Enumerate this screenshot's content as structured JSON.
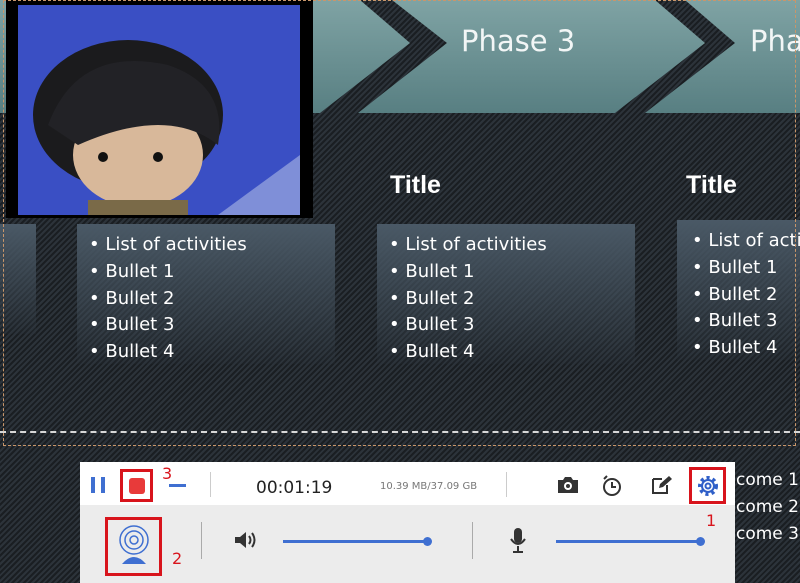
{
  "slide": {
    "phases": [
      "Phase 3",
      "Pha"
    ],
    "titles": [
      "Title",
      "Title"
    ],
    "columns": [
      [
        "• List of activities",
        "• Bullet 1",
        "• Bullet 2",
        "• Bullet 3",
        "• Bullet 4"
      ],
      [
        "• List of activities",
        "• Bullet 1",
        "• Bullet 2",
        "• Bullet 3",
        "• Bullet 4"
      ],
      [
        "• List of activi",
        "• Bullet 1",
        "• Bullet 2",
        "• Bullet 3",
        "• Bullet 4"
      ]
    ],
    "side_text": [
      "come 1",
      "come 2",
      "come 3"
    ]
  },
  "recorder": {
    "timer": "00:01:19",
    "storage": "10.39 MB/37.09 GB",
    "annotations": [
      "1",
      "2",
      "3"
    ],
    "speaker_volume": 100,
    "mic_volume": 100,
    "accent": "#3f6fd1",
    "highlight": "#d8141c"
  }
}
